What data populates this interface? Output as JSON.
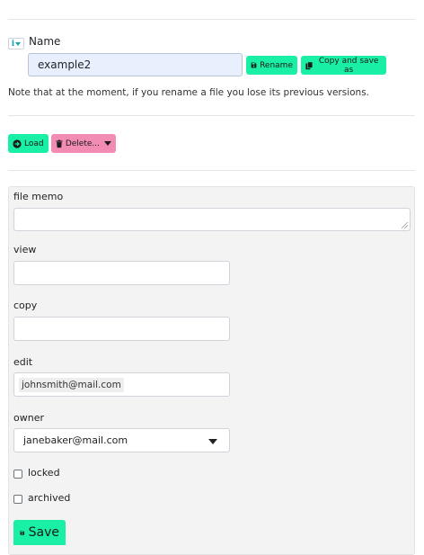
{
  "name_section": {
    "label": "Name",
    "value": "example2",
    "rename_label": "Rename",
    "copy_save_label": "Copy and save as",
    "note": "Note that at the moment, if you rename a file you lose its previous versions."
  },
  "actions": {
    "load_label": "Load",
    "delete_label": "Delete..."
  },
  "form": {
    "file_memo_label": "file memo",
    "file_memo_value": "",
    "view_label": "view",
    "view_value": "",
    "copy_label": "copy",
    "copy_value": "",
    "edit_label": "edit",
    "edit_chip": "johnsmith@mail.com",
    "owner_label": "owner",
    "owner_value": "janebaker@mail.com",
    "locked_label": "locked",
    "locked_checked": false,
    "archived_label": "archived",
    "archived_checked": false,
    "save_label": "Save"
  },
  "colors": {
    "accent_green": "#19f0a5",
    "delete_pink": "#f28cb4",
    "panel_bg": "#f3f3f3",
    "name_input_bg": "#e8f0fe"
  }
}
